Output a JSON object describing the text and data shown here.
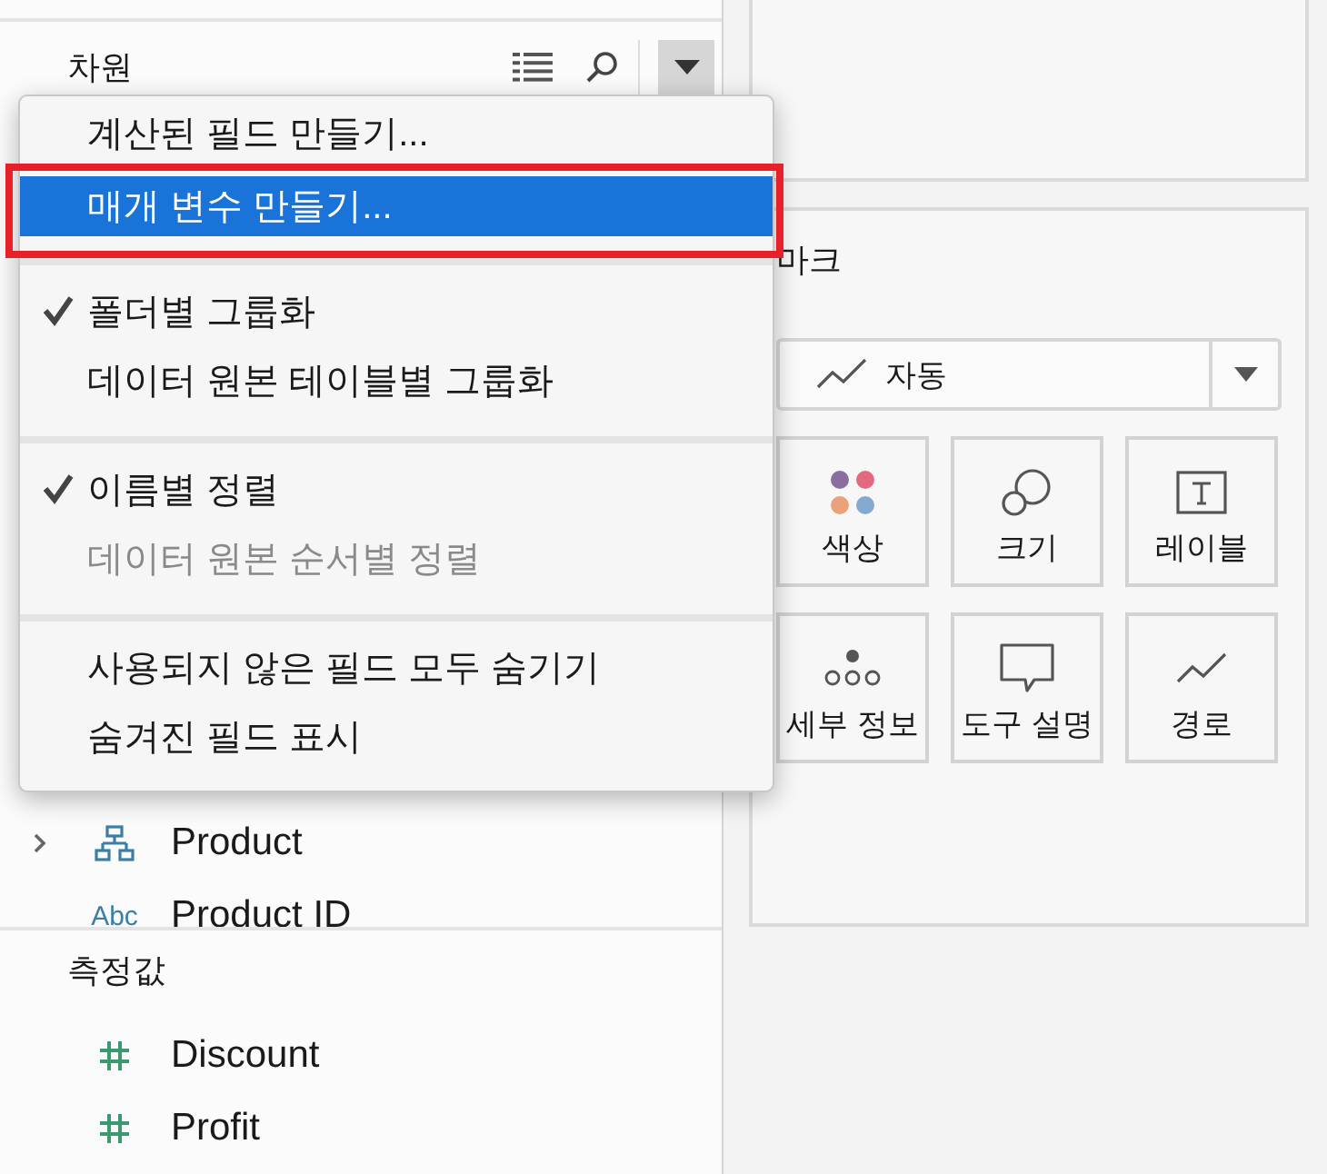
{
  "dimensions_panel": {
    "title": "차원",
    "rows": [
      {
        "kind": "hierarchy",
        "label": "Product",
        "expandable": true
      },
      {
        "kind": "text",
        "type_label": "Abc",
        "label": "Product ID",
        "expandable": false
      }
    ]
  },
  "context_menu": {
    "groups": [
      [
        {
          "label": "계산된 필드 만들기...",
          "selected": false,
          "checked": false,
          "disabled": false,
          "annotated": false
        },
        {
          "label": "매개 변수 만들기...",
          "selected": true,
          "checked": false,
          "disabled": false,
          "annotated": true
        }
      ],
      [
        {
          "label": "폴더별 그룹화",
          "selected": false,
          "checked": true,
          "disabled": false,
          "annotated": false
        },
        {
          "label": "데이터 원본 테이블별 그룹화",
          "selected": false,
          "checked": false,
          "disabled": false,
          "annotated": false
        }
      ],
      [
        {
          "label": "이름별 정렬",
          "selected": false,
          "checked": true,
          "disabled": false,
          "annotated": false
        },
        {
          "label": "데이터 원본 순서별 정렬",
          "selected": false,
          "checked": false,
          "disabled": true,
          "annotated": false
        }
      ],
      [
        {
          "label": "사용되지 않은 필드 모두 숨기기",
          "selected": false,
          "checked": false,
          "disabled": false,
          "annotated": false
        },
        {
          "label": "숨겨진 필드 표시",
          "selected": false,
          "checked": false,
          "disabled": false,
          "annotated": false
        }
      ]
    ]
  },
  "measures_panel": {
    "title": "측정값",
    "rows": [
      {
        "kind": "measure",
        "label": "Discount"
      },
      {
        "kind": "measure",
        "label": "Profit"
      }
    ]
  },
  "marks_card": {
    "title": "마크",
    "mark_type": "자동",
    "buttons": [
      {
        "kind": "color",
        "label": "색상"
      },
      {
        "kind": "size",
        "label": "크기"
      },
      {
        "kind": "label",
        "label": "레이블"
      },
      {
        "kind": "detail",
        "label": "세부 정보"
      },
      {
        "kind": "tooltip",
        "label": "도구 설명"
      },
      {
        "kind": "path",
        "label": "경로"
      }
    ]
  }
}
